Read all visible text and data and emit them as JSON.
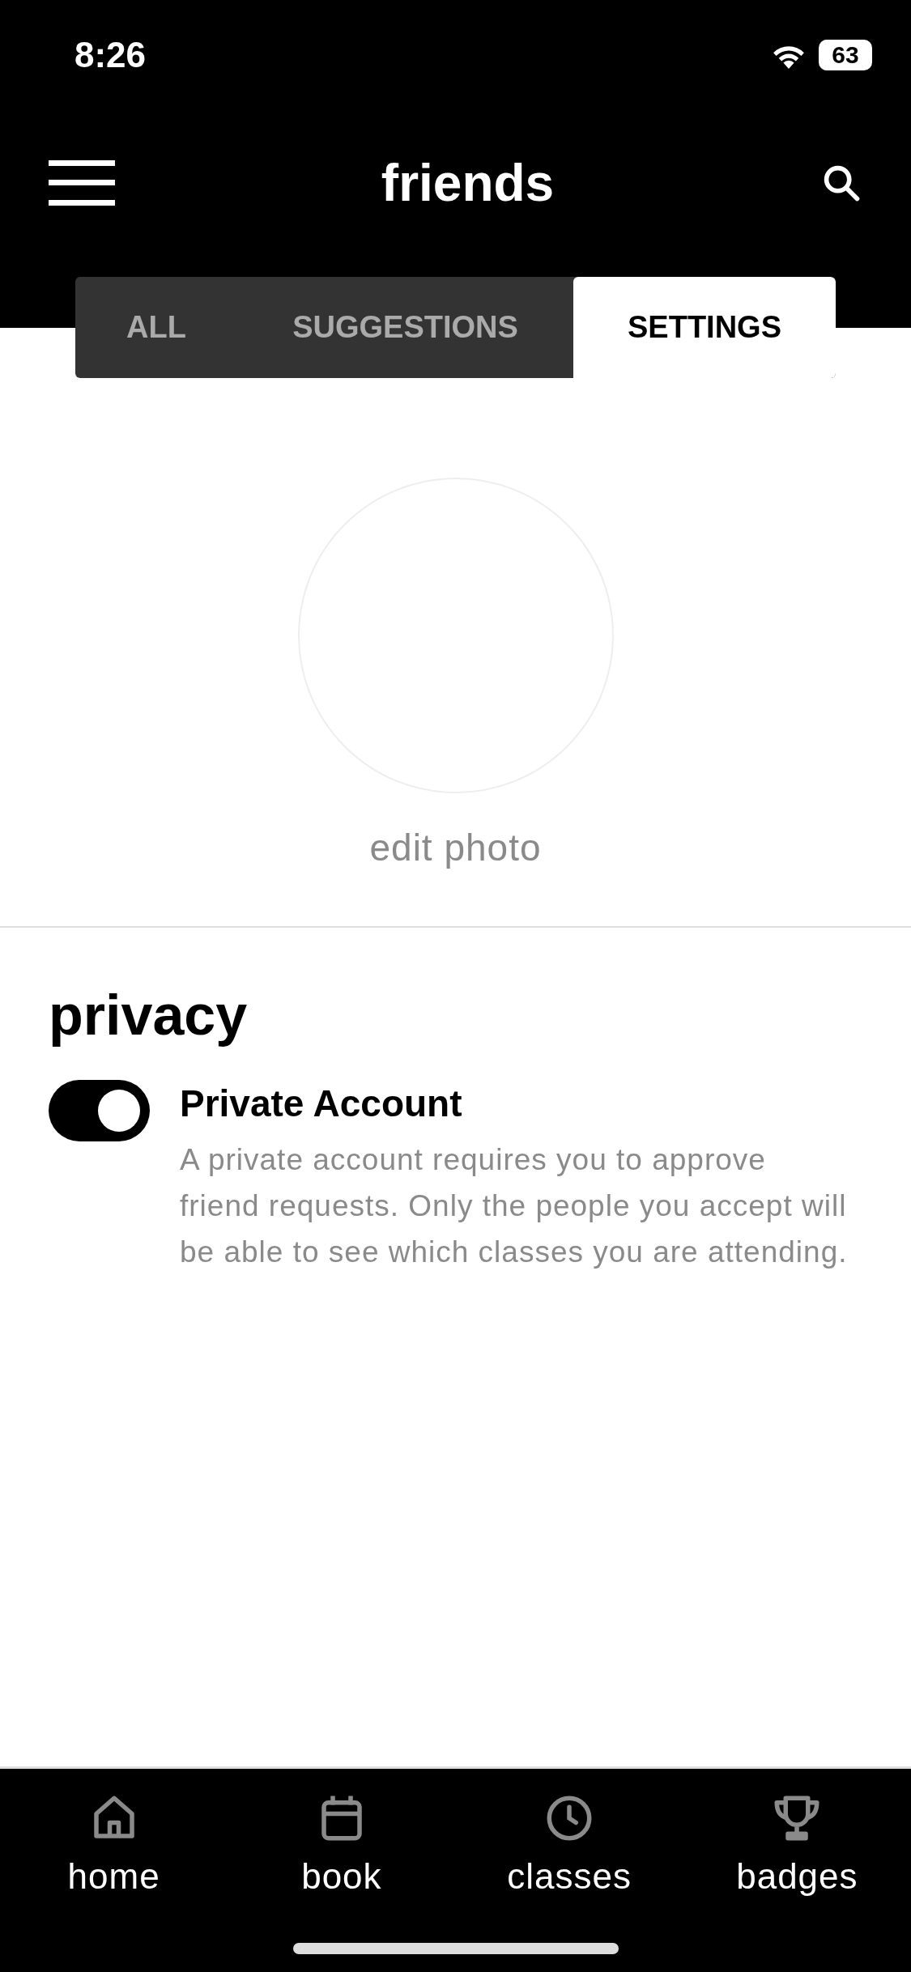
{
  "status_bar": {
    "time": "8:26",
    "battery": "63"
  },
  "header": {
    "title": "friends"
  },
  "tabs": [
    {
      "label": "ALL",
      "selected": false
    },
    {
      "label": "SUGGESTIONS",
      "selected": false
    },
    {
      "label": "SETTINGS",
      "selected": true
    }
  ],
  "profile": {
    "photo_action": "edit photo"
  },
  "privacy": {
    "heading": "privacy",
    "setting": {
      "label": "Private Account",
      "on": true,
      "description": "A private account requires you to approve friend requests. Only the people you accept will be able to see which classes you are attending."
    }
  },
  "bottom_nav": [
    {
      "label": "home"
    },
    {
      "label": "book"
    },
    {
      "label": "classes"
    },
    {
      "label": "badges"
    }
  ]
}
